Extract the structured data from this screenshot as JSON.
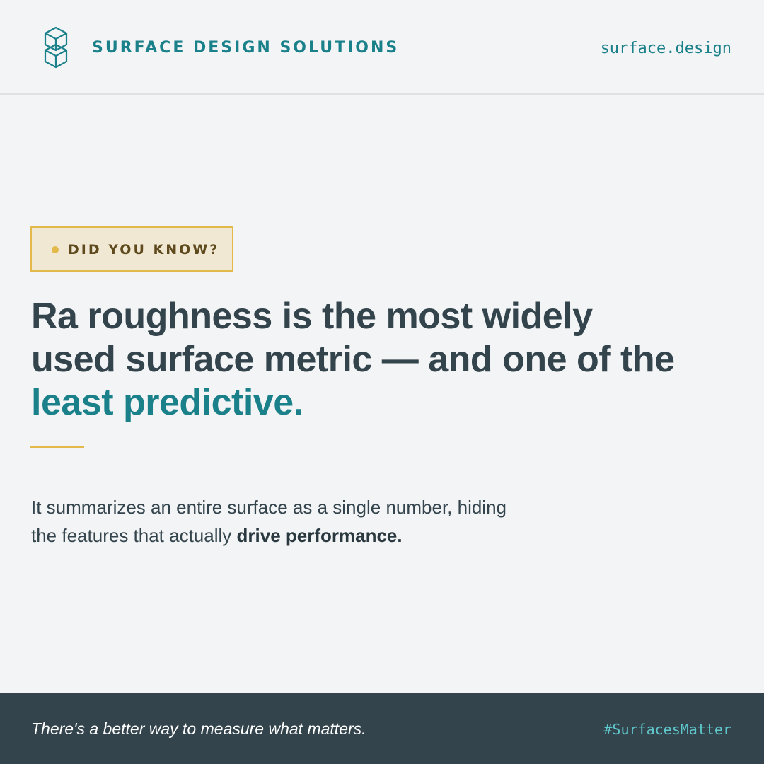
{
  "header": {
    "brand_name": "SURFACE DESIGN SOLUTIONS",
    "website": "surface.design",
    "logo_icon": "hexagon-cube-logo-icon"
  },
  "badge": {
    "label": "DID YOU KNOW?"
  },
  "headline": {
    "line1": "Ra roughness is the most widely",
    "line2": "used surface metric — and one of the",
    "accent": "least predictive."
  },
  "body": {
    "line1": "It summarizes an entire surface as a single number, hiding",
    "line2_prefix": "the features that actually ",
    "line2_bold": "drive performance."
  },
  "footer": {
    "tagline": "There's a better way to measure what matters.",
    "hashtag": "#SurfacesMatter"
  },
  "colors": {
    "background": "#f3f4f6",
    "primary_text": "#33444c",
    "accent_teal": "#1a8089",
    "accent_gold": "#e2b94a",
    "badge_fill": "#f1e8d4",
    "footer_bg": "#33444c",
    "hashtag": "#5fc8cc"
  }
}
